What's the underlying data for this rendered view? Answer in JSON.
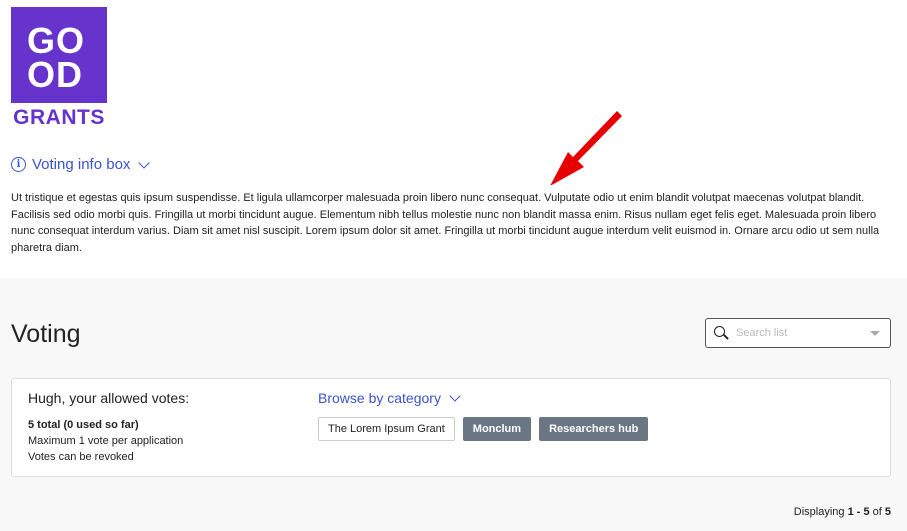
{
  "logo": {
    "line1": "GO",
    "line2": "OD",
    "line3": "GRANTS",
    "color": "#6633cc"
  },
  "info_box": {
    "toggle_label": "Voting info box",
    "text": "Ut tristique et egestas quis ipsum suspendisse. Et ligula ullamcorper malesuada proin libero nunc consequat. Vulputate odio ut enim blandit volutpat maecenas volutpat blandit. Facilisis sed odio morbi quis. Fringilla ut morbi tincidunt augue. Elementum nibh tellus molestie nunc non blandit massa enim. Risus nullam eget felis eget. Malesuada proin libero nunc consequat interdum varius. Diam sit amet nisl suscipit. Lorem ipsum dolor sit amet. Fringilla ut morbi tincidunt augue interdum velit euismod in. Ornare arcu odio ut sem nulla pharetra diam."
  },
  "voting": {
    "title": "Voting",
    "search": {
      "placeholder": "Search list"
    },
    "votes": {
      "heading": "Hugh, your allowed votes:",
      "total": "5 total (0 used so far)",
      "max_per_app": "Maximum 1 vote per application",
      "revoke": "Votes can be revoked"
    },
    "browse_label": "Browse by category",
    "categories": [
      {
        "label": "The Lorem Ipsum Grant",
        "active": false
      },
      {
        "label": "Monclum",
        "active": true
      },
      {
        "label": "Researchers hub",
        "active": true
      }
    ],
    "displaying": {
      "prefix": "Displaying ",
      "range": "1 - 5",
      "of": " of ",
      "total": "5"
    }
  },
  "colors": {
    "accent": "#3b54c9",
    "brand": "#6633cc",
    "tag": "#6b7685",
    "arrow": "#e60000"
  }
}
